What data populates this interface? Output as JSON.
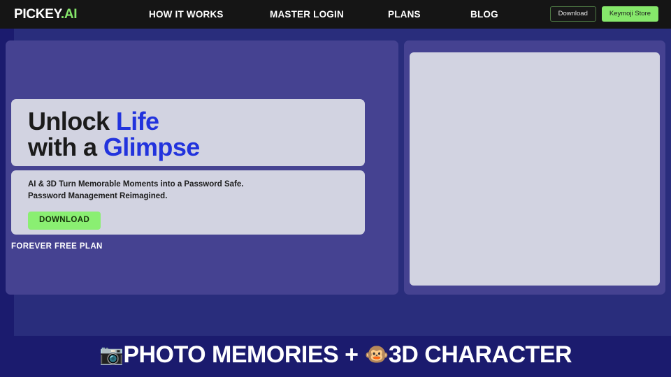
{
  "navbar": {
    "brand_main": "PICKEY",
    "brand_accent": ".AI",
    "links": [
      {
        "label": "HOW IT WORKS"
      },
      {
        "label": "MASTER LOGIN"
      },
      {
        "label": "PLANS"
      },
      {
        "label": "BLOG"
      }
    ],
    "download_button": "Download",
    "store_button": "Keymoji Store",
    "colors": {
      "background": "#151515",
      "accent_green": "#86e86b",
      "text": "#ffffff"
    }
  },
  "hero": {
    "headline_line1_plain": "Unlock ",
    "headline_line1_accent": "Life",
    "headline_line2_plain": "with a ",
    "headline_line2_accent": "Glimpse",
    "subtitle_line1": "AI & 3D Turn Memorable Moments into a Password Safe.",
    "subtitle_line2": "Password Management Reimagined.",
    "download_button": "DOWNLOAD",
    "free_plan_label": "FOREVER FREE PLAN",
    "colors": {
      "panel": "#d2d3e1",
      "card": "#454291",
      "accent_blue": "#2233dd",
      "button_green": "#8aef72"
    }
  },
  "media_panel": {
    "placeholder_label": ""
  },
  "banner": {
    "camera_emoji": "📷",
    "text_part1": "PHOTO MEMORIES + ",
    "monkey_emoji": "🐵",
    "text_part2": "3D CHARACTER",
    "colors": {
      "background": "#1b1b6e",
      "text": "#ffffff"
    }
  },
  "page": {
    "background": "#1b1b6e",
    "mid_background": "#292d7c"
  }
}
